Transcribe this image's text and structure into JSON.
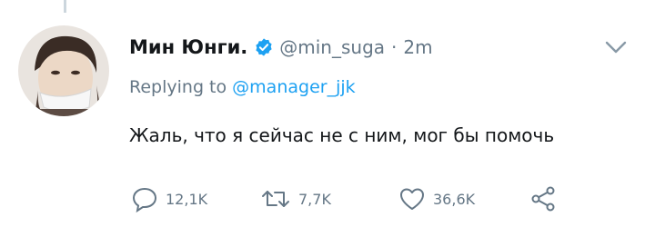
{
  "tweet": {
    "display_name": "Мин Юнги.",
    "handle": "@min_suga",
    "separator": "·",
    "time": "2m",
    "replying_prefix": "Replying to",
    "replying_to": "@manager_jjk",
    "text": "Жаль, что я сейчас не с ним, мог бы помочь",
    "verified": true
  },
  "actions": {
    "replies": "12,1K",
    "retweets": "7,7K",
    "likes": "36,6K"
  },
  "icons": {
    "verified": "verified-badge-icon",
    "menu": "chevron-down-icon",
    "reply": "reply-icon",
    "retweet": "retweet-icon",
    "like": "heart-icon",
    "share": "share-icon"
  },
  "colors": {
    "accent": "#1da1f2",
    "secondary_text": "#657786",
    "primary_text": "#14171a",
    "icon_gray": "#657786"
  }
}
